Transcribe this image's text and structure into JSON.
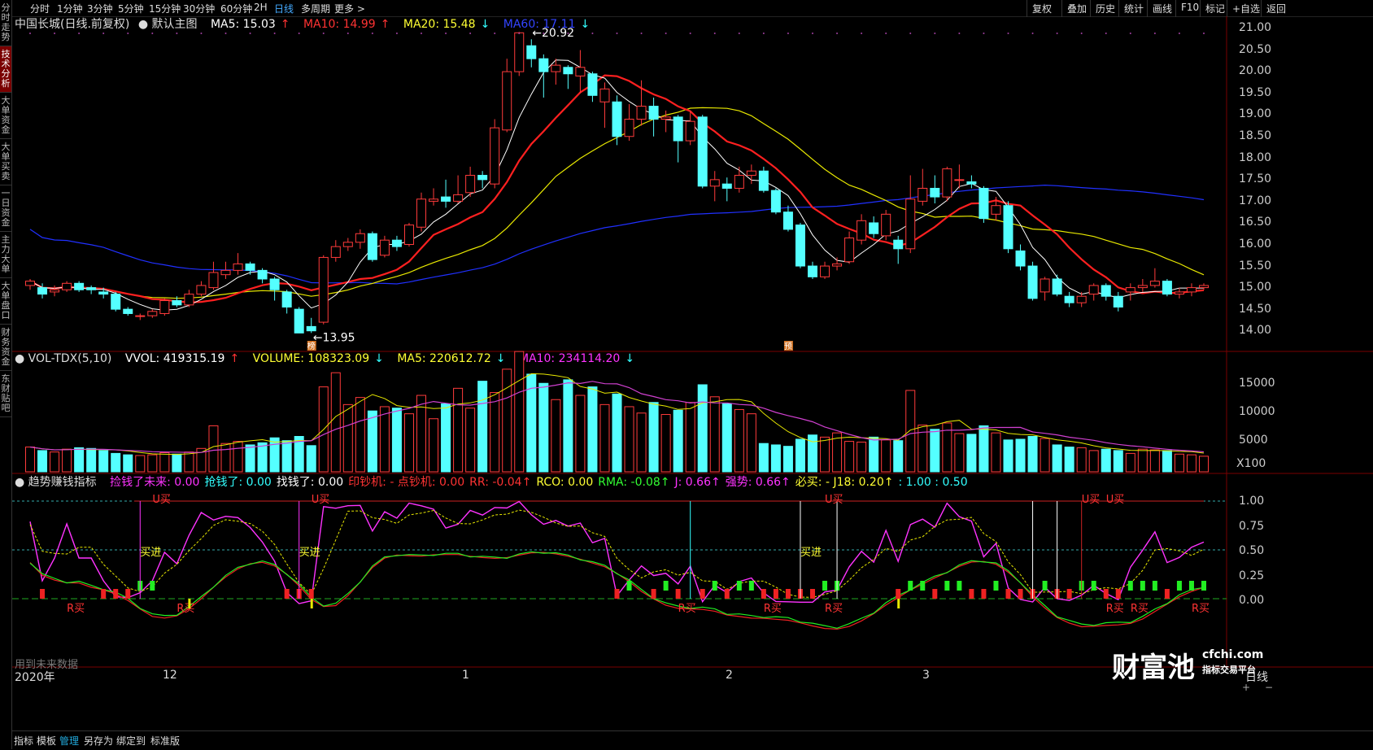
{
  "sidebar": {
    "items": [
      "分时走势",
      "技术分析",
      "大单资金",
      "大单买卖",
      "一日资金",
      "主力大单",
      "大单盘口",
      "财务资金",
      "东财贴吧"
    ],
    "active_index": 1
  },
  "toolbar": {
    "periods": [
      "分时",
      "1分钟",
      "3分钟",
      "5分钟",
      "15分钟",
      "30分钟",
      "60分钟",
      "2H",
      "日线",
      "多周期",
      "更多 >"
    ],
    "active_period": "日线",
    "right_buttons": [
      "复权",
      "叠加",
      "历史",
      "统计",
      "画线",
      "F10",
      "标记",
      "+自选",
      "返回"
    ]
  },
  "main": {
    "title": "中国长城(日线.前复权)",
    "template": "默认主图",
    "ma5": "MA5: 15.03",
    "ma5_arrow": "↑",
    "ma10": "MA10: 14.99",
    "ma10_arrow": "↑",
    "ma20": "MA20: 15.48",
    "ma20_arrow": "↓",
    "ma60": "MA60: 17.11",
    "ma60_arrow": "↓",
    "high_label": "20.92",
    "low_label": "13.95",
    "price_ticks": [
      "21.00",
      "20.50",
      "20.00",
      "19.50",
      "19.00",
      "18.50",
      "18.00",
      "17.50",
      "17.00",
      "16.50",
      "16.00",
      "15.50",
      "15.00",
      "14.50",
      "14.00"
    ],
    "marker_1": "榜",
    "marker_2": "预"
  },
  "volume": {
    "name": "VOL-TDX(5,10)",
    "vvol": "VVOL: 419315.19",
    "vvol_arrow": "↑",
    "volume": "VOLUME: 108323.09",
    "volume_arrow": "↓",
    "ma5": "MA5: 220612.72",
    "ma5_arrow": "↓",
    "ma10": "MA10: 234114.20",
    "ma10_arrow": "↓",
    "ticks": [
      "15000",
      "10000",
      "5000"
    ],
    "unit": "X100"
  },
  "indicator": {
    "name": "趋势赚钱指标",
    "items": [
      {
        "text": "捡钱了未来: 0.00",
        "color": "#ff33ff"
      },
      {
        "text": "抢钱了: 0.00",
        "color": "#33ffff"
      },
      {
        "text": "找钱了: 0.00",
        "color": "#ffffff"
      },
      {
        "text": "印钞机: - 点钞机: 0.00",
        "color": "#ff3333"
      },
      {
        "text": "RR: -0.04↑",
        "color": "#ff3333"
      },
      {
        "text": "RCO: 0.00",
        "color": "#ffff33"
      },
      {
        "text": "RMA: -0.08↑",
        "color": "#33ff33"
      },
      {
        "text": "J: 0.66↑",
        "color": "#ff33ff"
      },
      {
        "text": "强势: 0.66↑",
        "color": "#ff33ff"
      },
      {
        "text": "必买: - J18: 0.20↑",
        "color": "#ffff33"
      },
      {
        "text": ": 1.00 : 0.50",
        "color": "#33ffff"
      }
    ],
    "ticks": [
      "1.00",
      "0.75",
      "0.50",
      "0.25",
      "0.00"
    ],
    "future_note": "用到未来数据",
    "signal_u_buy": "U买",
    "signal_r_buy": "R买",
    "signal_buy_in": "买进",
    "signal_buy_in_2": "买进"
  },
  "time_axis": {
    "year_label": "2020年",
    "months": [
      "12",
      "1",
      "2",
      "3"
    ],
    "period_label": "日线"
  },
  "bottom": {
    "tabs": [
      "指标",
      "模板",
      "管理",
      "另存为",
      "绑定到",
      "标准版"
    ],
    "active": "管理"
  },
  "watermark": {
    "brand": "财富池",
    "domain": "cfchi.com",
    "tagline": "指标交易平台"
  },
  "colors": {
    "up": "#ff3b3b",
    "down": "#54ffff",
    "ma5": "#ffffff",
    "ma10": "#ff2020",
    "ma20": "#e8e800",
    "ma60": "#2030ff"
  }
}
